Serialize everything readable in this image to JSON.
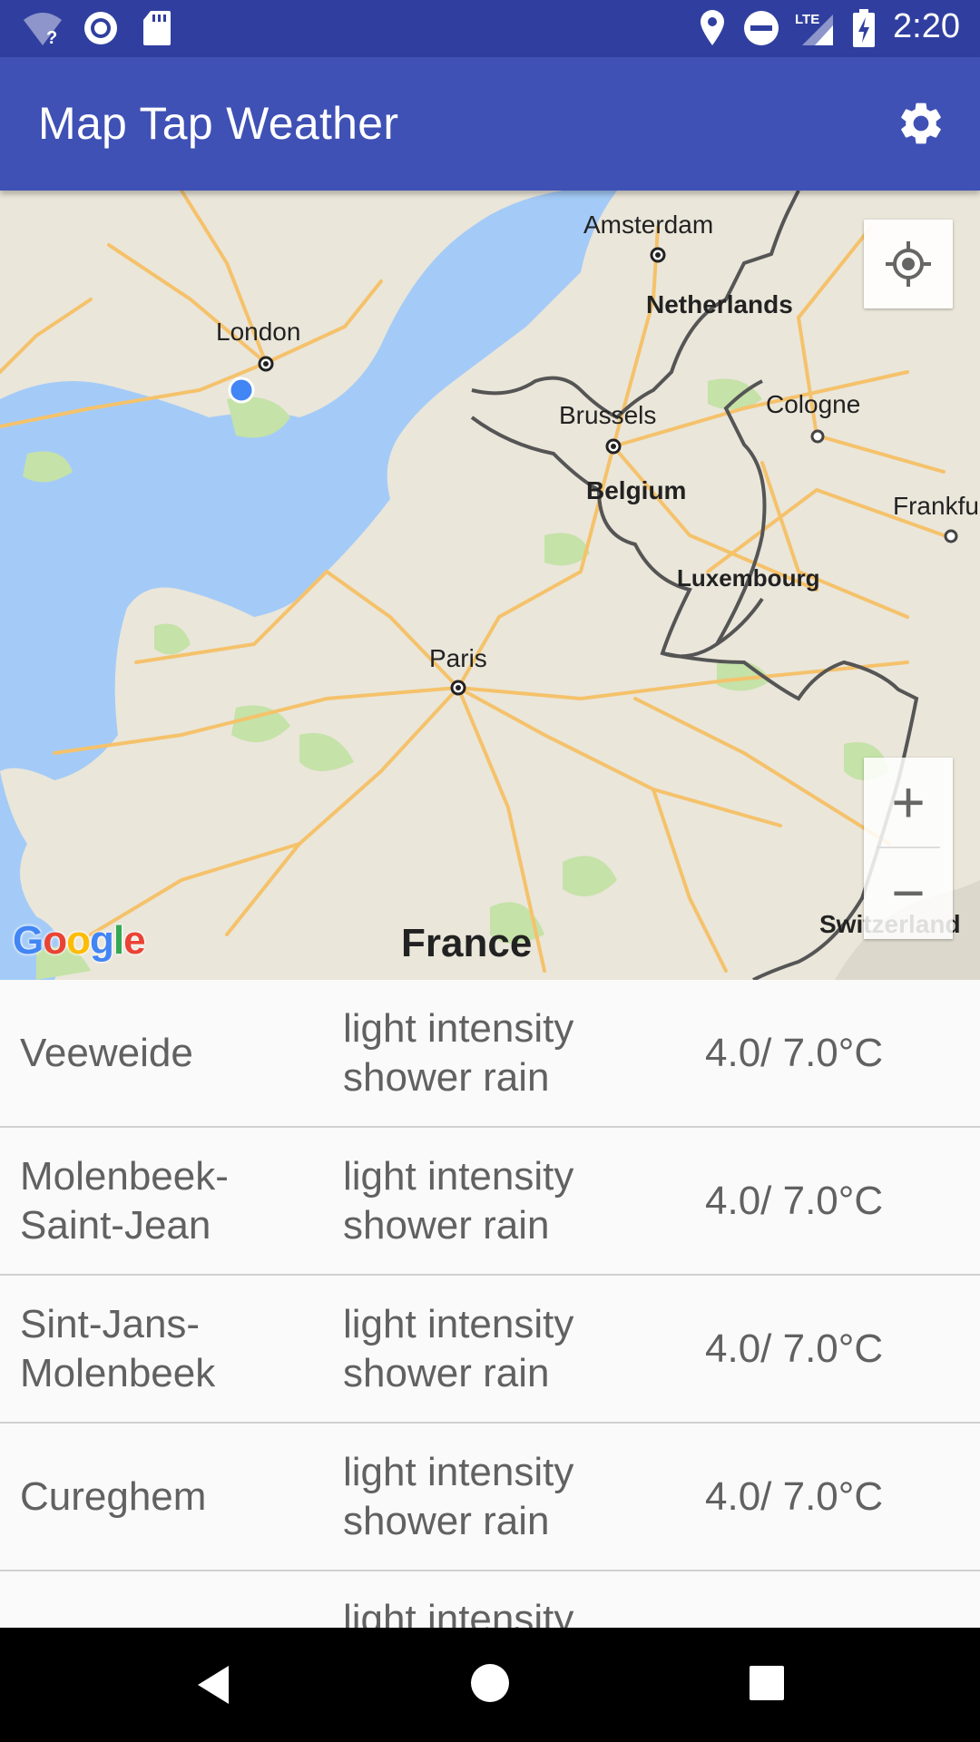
{
  "status_bar": {
    "time": "2:20",
    "icons": [
      "wifi-question-icon",
      "sync-icon",
      "sd-card-icon",
      "location-icon",
      "do-not-disturb-icon",
      "lte-signal-icon",
      "battery-charging-icon"
    ],
    "lte_label": "LTE"
  },
  "app_bar": {
    "title": "Map Tap Weather",
    "settings_icon": "gear-icon"
  },
  "map": {
    "labels": {
      "amsterdam": "Amsterdam",
      "netherlands": "Netherlands",
      "london": "London",
      "brussels": "Brussels",
      "cologne": "Cologne",
      "belgium": "Belgium",
      "frankfurt": "Frankfu",
      "luxembourg": "Luxembourg",
      "paris": "Paris",
      "switzerland": "Switzerland",
      "france": "France"
    },
    "zoom_in": "+",
    "zoom_out": "−",
    "logo": "Google",
    "colors": {
      "water": "#a4cbf7",
      "land": "#eae6da",
      "green": "#c5e2a8",
      "road": "#f5c26b",
      "border": "#555555",
      "marker": "#4285f4"
    }
  },
  "weather_list": {
    "rows": [
      {
        "city": "Veeweide",
        "description": "light intensity shower rain",
        "temperature": "4.0/ 7.0°C"
      },
      {
        "city": "Molenbeek-Saint-Jean",
        "description": "light intensity shower rain",
        "temperature": "4.0/ 7.0°C"
      },
      {
        "city": "Sint-Jans-Molenbeek",
        "description": "light intensity shower rain",
        "temperature": "4.0/ 7.0°C"
      },
      {
        "city": "Cureghem",
        "description": "light intensity shower rain",
        "temperature": "4.0/ 7.0°C"
      },
      {
        "city": "",
        "description": "light intensity",
        "temperature": ""
      }
    ]
  },
  "nav_bar": {
    "back_icon": "back-triangle-icon",
    "home_icon": "home-circle-icon",
    "recents_icon": "recents-square-icon"
  }
}
